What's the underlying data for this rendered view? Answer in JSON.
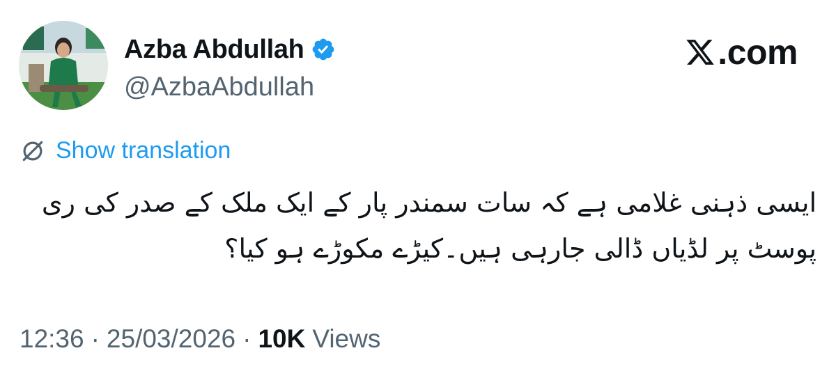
{
  "author": {
    "name": "Azba Abdullah",
    "handle": "@AzbaAbdullah",
    "verified": true
  },
  "brand": {
    "label": ".com"
  },
  "translation": {
    "label": "Show translation"
  },
  "tweet": {
    "text": "ایسی ذہنی غلامی ہے کہ سات سمندر پار کے ایک ملک کے صدر کی ری پوسٹ پر لڈیاں ڈالی جارہی ہیں۔کیڑے مکوڑے ہو کیا؟"
  },
  "meta": {
    "time": "12:36",
    "separator": "·",
    "date": "25/03/2026",
    "views_count": "10K",
    "views_label": "Views"
  },
  "colors": {
    "link": "#1d9bf0",
    "secondary_text": "#536471",
    "primary_text": "#0f1419",
    "verified_badge": "#1d9bf0"
  }
}
